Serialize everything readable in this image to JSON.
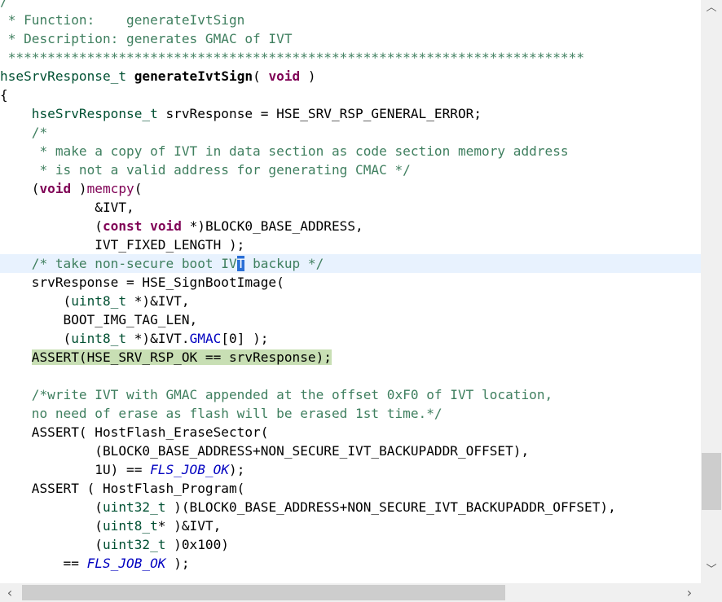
{
  "editor": {
    "lines": [
      {
        "segs": [
          {
            "t": "/",
            "c": "comment"
          }
        ]
      },
      {
        "segs": [
          {
            "t": " * Function:    generateIvtSign",
            "c": "comment"
          }
        ]
      },
      {
        "segs": [
          {
            "t": " * Description: generates GMAC of IVT",
            "c": "comment"
          }
        ]
      },
      {
        "segs": [
          {
            "t": " *************************************************************************",
            "c": "comment"
          }
        ]
      },
      {
        "segs": [
          {
            "t": "hseSrvResponse_t",
            "c": "type"
          },
          {
            "t": " ",
            "c": "plain"
          },
          {
            "t": "generateIvtSign",
            "c": "func-bold"
          },
          {
            "t": "( ",
            "c": "plain"
          },
          {
            "t": "void",
            "c": "keyword"
          },
          {
            "t": " )",
            "c": "plain"
          }
        ]
      },
      {
        "segs": [
          {
            "t": "{",
            "c": "plain"
          }
        ]
      },
      {
        "segs": [
          {
            "t": "    ",
            "c": "plain"
          },
          {
            "t": "hseSrvResponse_t",
            "c": "type"
          },
          {
            "t": " srvResponse = HSE_SRV_RSP_GENERAL_ERROR;",
            "c": "plain"
          }
        ]
      },
      {
        "segs": [
          {
            "t": "    /*",
            "c": "comment"
          }
        ]
      },
      {
        "segs": [
          {
            "t": "     * make a copy of IVT in data section as code section memory address",
            "c": "comment"
          }
        ]
      },
      {
        "segs": [
          {
            "t": "     * is not a valid address for generating CMAC */",
            "c": "comment"
          }
        ]
      },
      {
        "segs": [
          {
            "t": "    (",
            "c": "plain"
          },
          {
            "t": "void",
            "c": "keyword"
          },
          {
            "t": " )",
            "c": "plain"
          },
          {
            "t": "memcpy",
            "c": "func-call"
          },
          {
            "t": "(",
            "c": "plain"
          }
        ]
      },
      {
        "segs": [
          {
            "t": "            &IVT,",
            "c": "plain"
          }
        ]
      },
      {
        "segs": [
          {
            "t": "            (",
            "c": "plain"
          },
          {
            "t": "const",
            "c": "keyword"
          },
          {
            "t": " ",
            "c": "plain"
          },
          {
            "t": "void",
            "c": "keyword"
          },
          {
            "t": " *)BLOCK0_BASE_ADDRESS,",
            "c": "plain"
          }
        ]
      },
      {
        "segs": [
          {
            "t": "            IVT_FIXED_LENGTH );",
            "c": "plain"
          }
        ]
      },
      {
        "current": true,
        "segs": [
          {
            "t": "    /* take non-secure boot IV",
            "c": "comment"
          },
          {
            "t": "T",
            "c": "sel"
          },
          {
            "t": " backup */",
            "c": "comment"
          }
        ]
      },
      {
        "segs": [
          {
            "t": "    srvResponse = HSE_SignBootImage(",
            "c": "plain"
          }
        ]
      },
      {
        "segs": [
          {
            "t": "        (",
            "c": "plain"
          },
          {
            "t": "uint8_t",
            "c": "type"
          },
          {
            "t": " *)&IVT,",
            "c": "plain"
          }
        ]
      },
      {
        "segs": [
          {
            "t": "        BOOT_IMG_TAG_LEN,",
            "c": "plain"
          }
        ]
      },
      {
        "segs": [
          {
            "t": "        (",
            "c": "plain"
          },
          {
            "t": "uint8_t",
            "c": "type"
          },
          {
            "t": " *)&IVT.",
            "c": "plain"
          },
          {
            "t": "GMAC",
            "c": "field"
          },
          {
            "t": "[0] );",
            "c": "plain"
          }
        ]
      },
      {
        "segs": [
          {
            "t": "    ",
            "c": "plain"
          },
          {
            "t": "ASSERT(HSE_SRV_RSP_OK == srvResponse);",
            "c": "hl"
          }
        ]
      },
      {
        "segs": [
          {
            "t": "",
            "c": "plain"
          }
        ]
      },
      {
        "segs": [
          {
            "t": "    /*write IVT with GMAC appended at the offset 0xF0 of IVT location,",
            "c": "comment"
          }
        ]
      },
      {
        "segs": [
          {
            "t": "    no need of erase as flash will be erased 1st time.*/",
            "c": "comment"
          }
        ]
      },
      {
        "segs": [
          {
            "t": "    ASSERT( HostFlash_EraseSector(",
            "c": "plain"
          }
        ]
      },
      {
        "segs": [
          {
            "t": "            (BLOCK0_BASE_ADDRESS+NON_SECURE_IVT_BACKUPADDR_OFFSET),",
            "c": "plain"
          }
        ]
      },
      {
        "segs": [
          {
            "t": "            1U) == ",
            "c": "plain"
          },
          {
            "t": "FLS_JOB_OK",
            "c": "enum"
          },
          {
            "t": ");",
            "c": "plain"
          }
        ]
      },
      {
        "segs": [
          {
            "t": "    ASSERT ( HostFlash_Program(",
            "c": "plain"
          }
        ]
      },
      {
        "segs": [
          {
            "t": "            (",
            "c": "plain"
          },
          {
            "t": "uint32_t",
            "c": "type"
          },
          {
            "t": " )(BLOCK0_BASE_ADDRESS+NON_SECURE_IVT_BACKUPADDR_OFFSET),",
            "c": "plain"
          }
        ]
      },
      {
        "segs": [
          {
            "t": "            (",
            "c": "plain"
          },
          {
            "t": "uint8_t",
            "c": "type"
          },
          {
            "t": "* )&IVT,",
            "c": "plain"
          }
        ]
      },
      {
        "segs": [
          {
            "t": "            (",
            "c": "plain"
          },
          {
            "t": "uint32_t",
            "c": "type"
          },
          {
            "t": " )0x100)",
            "c": "plain"
          }
        ]
      },
      {
        "segs": [
          {
            "t": "        == ",
            "c": "plain"
          },
          {
            "t": "FLS_JOB_OK",
            "c": "enum"
          },
          {
            "t": " );",
            "c": "plain"
          }
        ]
      }
    ]
  },
  "scrollbars": {
    "up_icon": "chevron-up-icon",
    "up_glyph": "︿",
    "down_icon": "chevron-down-icon",
    "down_glyph": "﹀",
    "left_icon": "chevron-left-icon",
    "left_glyph": "‹",
    "right_icon": "chevron-right-icon",
    "right_glyph": "›"
  }
}
